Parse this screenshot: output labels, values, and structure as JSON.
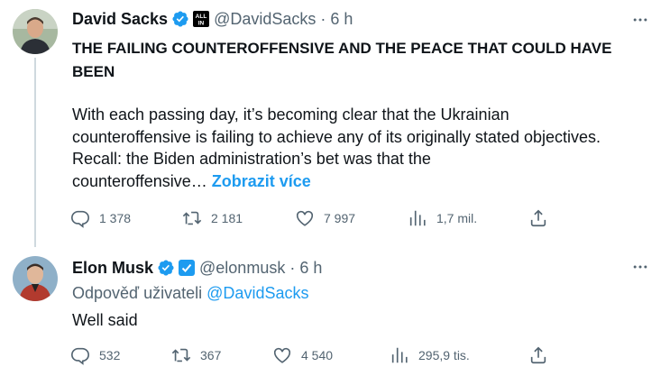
{
  "tweets": [
    {
      "author_name": "David Sacks",
      "affiliation_badge": "ALL IN",
      "handle": "@DavidSacks",
      "separator": "·",
      "time": "6 h",
      "headline_line1": "THE FAILING COUNTEROFFENSIVE AND THE PEACE THAT COULD HAVE",
      "headline_line2": "BEEN",
      "body_line1": "With each passing day, it’s becoming clear that the Ukrainian",
      "body_line2": "counteroffensive is failing to achieve any of its originally stated objectives.",
      "body_line3": "Recall: the Biden administration’s bet was that the",
      "body_line4": "counteroffensive…",
      "show_more": "Zobrazit více",
      "replies": "1 378",
      "retweets": "2 181",
      "likes": "7 997",
      "views": "1,7 mil."
    },
    {
      "author_name": "Elon Musk",
      "handle": "@elonmusk",
      "separator": "·",
      "time": "6 h",
      "reply_prefix": "Odpověď uživateli",
      "reply_mention": "@DavidSacks",
      "body": "Well said",
      "replies": "532",
      "retweets": "367",
      "likes": "4 540",
      "views": "295,9 tis."
    }
  ],
  "icons": {
    "verified": "verified-badge-icon",
    "more": "more-icon",
    "reply": "reply-icon",
    "retweet": "retweet-icon",
    "like": "like-icon",
    "views": "views-icon",
    "share": "share-icon"
  },
  "colors": {
    "accent": "#1d9bf0",
    "text": "#0f1419",
    "secondary": "#536471",
    "thread_line": "#cfd9de",
    "affiliation_blue": "#1d9bf0"
  }
}
